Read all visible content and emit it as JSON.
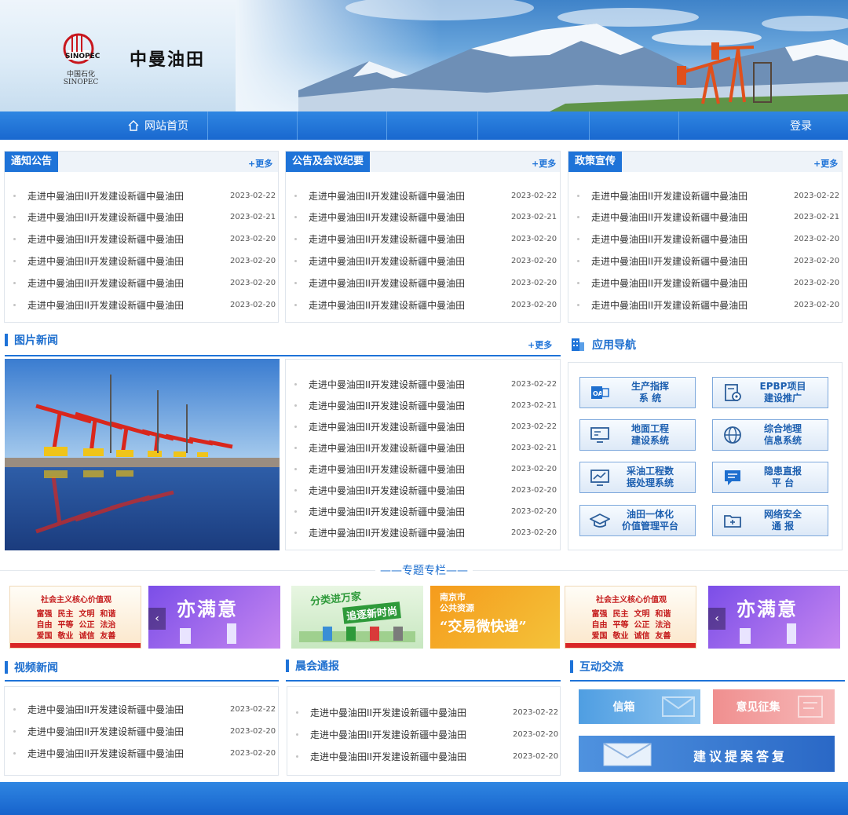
{
  "header": {
    "logo_alt": "SINOPEC",
    "logo_cn": "中国石化",
    "logo_en": "SINOPEC",
    "site_title": "中曼油田"
  },
  "nav": {
    "home_label": "网站首页",
    "login_label": "登录"
  },
  "panels": {
    "notice": {
      "title": "通知公告",
      "more": "+更多"
    },
    "meeting": {
      "title": "公告及会议纪要",
      "more": "+更多"
    },
    "policy": {
      "title": "政策宣传",
      "more": "+更多"
    }
  },
  "news_items": [
    {
      "title": "走进中曼油田II开发建设新疆中曼油田",
      "date": "2023-02-22"
    },
    {
      "title": "走进中曼油田II开发建设新疆中曼油田",
      "date": "2023-02-21"
    },
    {
      "title": "走进中曼油田II开发建设新疆中曼油田",
      "date": "2023-02-20"
    },
    {
      "title": "走进中曼油田II开发建设新疆中曼油田",
      "date": "2023-02-20"
    },
    {
      "title": "走进中曼油田II开发建设新疆中曼油田",
      "date": "2023-02-20"
    },
    {
      "title": "走进中曼油田II开发建设新疆中曼油田",
      "date": "2023-02-20"
    }
  ],
  "picnews": {
    "title": "图片新闻",
    "more": "+更多",
    "items": [
      {
        "title": "走进中曼油田II开发建设新疆中曼油田",
        "date": "2023-02-22"
      },
      {
        "title": "走进中曼油田II开发建设新疆中曼油田",
        "date": "2023-02-21"
      },
      {
        "title": "走进中曼油田II开发建设新疆中曼油田",
        "date": "2023-02-22"
      },
      {
        "title": "走进中曼油田II开发建设新疆中曼油田",
        "date": "2023-02-21"
      },
      {
        "title": "走进中曼油田II开发建设新疆中曼油田",
        "date": "2023-02-20"
      },
      {
        "title": "走进中曼油田II开发建设新疆中曼油田",
        "date": "2023-02-20"
      },
      {
        "title": "走进中曼油田II开发建设新疆中曼油田",
        "date": "2023-02-20"
      },
      {
        "title": "走进中曼油田II开发建设新疆中曼油田",
        "date": "2023-02-20"
      }
    ]
  },
  "appnav": {
    "title": "应用导航",
    "buttons": [
      {
        "label": "生产指挥\n系  统",
        "icon": "oa-icon"
      },
      {
        "label": "EPBP项目\n建设推广",
        "icon": "document-gear-icon"
      },
      {
        "label": "地面工程\n建设系统",
        "icon": "monitor-icon"
      },
      {
        "label": "综合地理\n信息系统",
        "icon": "globe-icon"
      },
      {
        "label": "采油工程数\n据处理系统",
        "icon": "chart-monitor-icon"
      },
      {
        "label": "隐患直报\n平  台",
        "icon": "message-icon"
      },
      {
        "label": "油田一体化\n价值管理平台",
        "icon": "graduation-cap-icon"
      },
      {
        "label": "网络安全\n通  报",
        "icon": "folder-plus-icon"
      }
    ]
  },
  "special": {
    "title": "——专题专栏——",
    "banners": [
      {
        "line1": "社会主义核心价值观",
        "line2": "富强  民主  文明  和谐",
        "line3": "自由  平等  公正  法治",
        "line4": "爱国  敬业  诚信  友善"
      },
      {
        "text": "亦满意"
      },
      {
        "line1": "分类进万家",
        "line2": "追逐新时尚"
      },
      {
        "line1": "南京市",
        "line2": "公共资源",
        "line3": "“交易微快递”"
      },
      {
        "line1": "社会主义核心价值观",
        "line2": "富强  民主  文明  和谐",
        "line3": "自由  平等  公正  法治",
        "line4": "爱国  敬业  诚信  友善"
      },
      {
        "text": "亦满意"
      }
    ]
  },
  "video": {
    "title": "视频新闻",
    "items": [
      {
        "title": "走进中曼油田II开发建设新疆中曼油田",
        "date": "2023-02-22"
      },
      {
        "title": "走进中曼油田II开发建设新疆中曼油田",
        "date": "2023-02-20"
      },
      {
        "title": "走进中曼油田II开发建设新疆中曼油田",
        "date": "2023-02-20"
      }
    ]
  },
  "morning": {
    "title": "晨会通报",
    "items": [
      {
        "title": "走进中曼油田II开发建设新疆中曼油田",
        "date": "2023-02-22"
      },
      {
        "title": "走进中曼油田II开发建设新疆中曼油田",
        "date": "2023-02-20"
      },
      {
        "title": "走进中曼油田II开发建设新疆中曼油田",
        "date": "2023-02-20"
      }
    ]
  },
  "interact": {
    "title": "互动交流",
    "mailbox": "信箱",
    "feedback": "意见征集",
    "proposal": "建议提案答复"
  },
  "colors": {
    "primary": "#1e73d8",
    "nav": "#1968cf",
    "mail": "#5aa7e6",
    "feedback": "#f2a3a3",
    "proposal": "#2f76cf"
  }
}
